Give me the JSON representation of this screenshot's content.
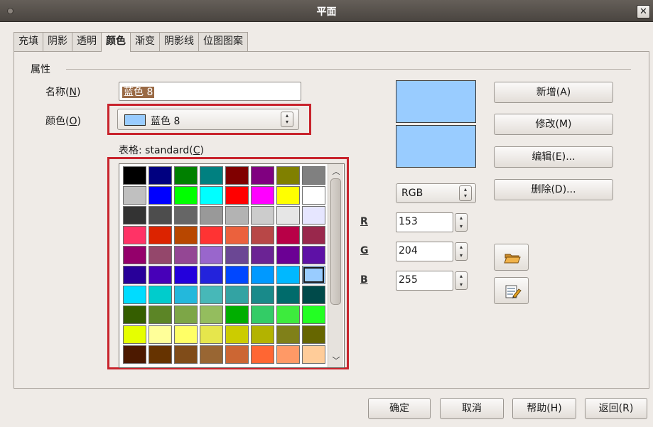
{
  "window": {
    "title": "平面"
  },
  "tabs": [
    {
      "label": "充填"
    },
    {
      "label": "阴影"
    },
    {
      "label": "透明"
    },
    {
      "label": "颜色"
    },
    {
      "label": "渐变"
    },
    {
      "label": "阴影线"
    },
    {
      "label": "位图图案"
    }
  ],
  "active_tab": "颜色",
  "section_title": "属性",
  "name_field": {
    "label": "名称",
    "accel": "N",
    "value": "蓝色 8"
  },
  "color_field": {
    "label": "颜色",
    "accel": "O",
    "value": "蓝色 8",
    "swatch": "#99ccff"
  },
  "table_label": {
    "text": "表格: standard",
    "accel": "C"
  },
  "palette": [
    "#000000",
    "#000080",
    "#008000",
    "#008080",
    "#800000",
    "#800080",
    "#808000",
    "#808080",
    "#c0c0c0",
    "#0000ff",
    "#00ff00",
    "#00ffff",
    "#ff0000",
    "#ff00ff",
    "#ffff00",
    "#ffffff",
    "#333333",
    "#4d4d4d",
    "#666666",
    "#999999",
    "#b3b3b3",
    "#cccccc",
    "#e6e6e6",
    "#e6e6ff",
    "#ff3366",
    "#dc2300",
    "#b84700",
    "#ff3333",
    "#eb613d",
    "#b84747",
    "#b80047",
    "#99284c",
    "#94006b",
    "#94476b",
    "#944794",
    "#9966cc",
    "#6b4794",
    "#6b2394",
    "#6b0094",
    "#5e11a6",
    "#280099",
    "#4700b8",
    "#2300dc",
    "#2323dc",
    "#0047ff",
    "#0099ff",
    "#00b8ff",
    "#99ccff",
    "#00dcff",
    "#00cccc",
    "#23b8dc",
    "#47b8b8",
    "#33a3a3",
    "#198a8a",
    "#006b6b",
    "#004a4a",
    "#355e00",
    "#5c8526",
    "#7da647",
    "#94bd5e",
    "#00ae00",
    "#33cc66",
    "#3deb3d",
    "#23ff23",
    "#e6ff00",
    "#ffff99",
    "#ffff66",
    "#e6e64c",
    "#cccc00",
    "#b3b300",
    "#808019",
    "#666600",
    "#4c1900",
    "#663300",
    "#804c19",
    "#996633",
    "#cc6633",
    "#ff6633",
    "#ff9966",
    "#ffcc99"
  ],
  "selected_color_index": 47,
  "preview": {
    "old_color": "#99ccff",
    "new_color": "#99ccff"
  },
  "color_model": "RGB",
  "channels": [
    {
      "label": "R",
      "value": "153"
    },
    {
      "label": "G",
      "value": "204"
    },
    {
      "label": "B",
      "value": "255"
    }
  ],
  "side_buttons": {
    "add": "新增(A)",
    "modify": "修改(M)",
    "edit": "编辑(E)...",
    "delete": "删除(D)..."
  },
  "icons": {
    "load": "folder-open-icon",
    "save": "save-list-icon"
  },
  "footer": {
    "ok": "确定",
    "cancel": "取消",
    "help": "帮助(H)",
    "reset": "返回(R)"
  },
  "colors": {
    "highlight": "#c8232c",
    "selection": "#9a6a45",
    "preview": "#99ccff"
  }
}
